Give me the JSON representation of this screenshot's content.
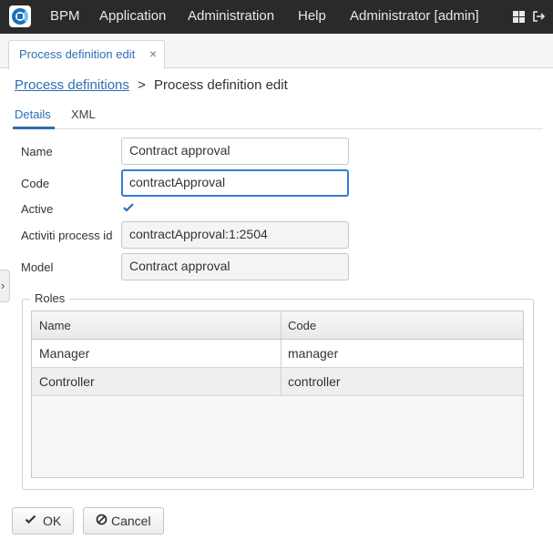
{
  "topbar": {
    "menu": [
      "BPM",
      "Application",
      "Administration",
      "Help"
    ],
    "user": "Administrator [admin]",
    "icons": [
      "app-logo-icon",
      "apps-grid-icon",
      "logout-icon"
    ]
  },
  "tab": {
    "label": "Process definition edit",
    "close": "×"
  },
  "breadcrumb": {
    "link": "Process definitions",
    "separator": ">",
    "current": "Process definition edit"
  },
  "subtabs": [
    "Details",
    "XML"
  ],
  "form": {
    "name_label": "Name",
    "name_value": "Contract approval",
    "code_label": "Code",
    "code_value": "contractApproval",
    "active_label": "Active",
    "active_checked": true,
    "process_id_label": "Activiti process id",
    "process_id_value": "contractApproval:1:2504",
    "model_label": "Model",
    "model_value": "Contract approval"
  },
  "roles": {
    "legend": "Roles",
    "columns": [
      "Name",
      "Code"
    ],
    "rows": [
      [
        "Manager",
        "manager"
      ],
      [
        "Controller",
        "controller"
      ]
    ]
  },
  "buttons": {
    "ok": "OK",
    "cancel": "Cancel"
  },
  "colors": {
    "accent": "#2f6fb1",
    "topbar": "#2a2a2a"
  }
}
